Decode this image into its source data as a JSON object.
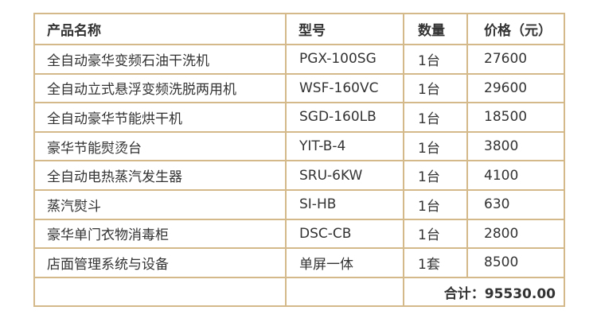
{
  "table": {
    "headers": {
      "name": "产品名称",
      "model": "型号",
      "qty": "数量",
      "price": "价格（元）"
    },
    "rows": [
      {
        "name": "全自动豪华变频石油干洗机",
        "model": "PGX-100SG",
        "qty": "1台",
        "price": "27600"
      },
      {
        "name": "全自动立式悬浮变频洗脱两用机",
        "model": "WSF-160VC",
        "qty": "1台",
        "price": "29600"
      },
      {
        "name": "全自动豪华节能烘干机",
        "model": "SGD-160LB",
        "qty": "1台",
        "price": "18500"
      },
      {
        "name": "豪华节能熨烫台",
        "model": "YIT-B-4",
        "qty": "1台",
        "price": "3800"
      },
      {
        "name": "全自动电热蒸汽发生器",
        "model": "SRU-6KW",
        "qty": "1台",
        "price": "4100"
      },
      {
        "name": "蒸汽熨斗",
        "model": "SI-HB",
        "qty": "1台",
        "price": "630"
      },
      {
        "name": "豪华单门衣物消毒柜",
        "model": "DSC-CB",
        "qty": "1台",
        "price": "2800"
      },
      {
        "name": "店面管理系统与设备",
        "model": "单屏一体",
        "qty": "1套",
        "price": "8500"
      }
    ],
    "total": "合计：95530.00"
  },
  "colors": {
    "border": "#d4b98a",
    "text": "#333333"
  }
}
